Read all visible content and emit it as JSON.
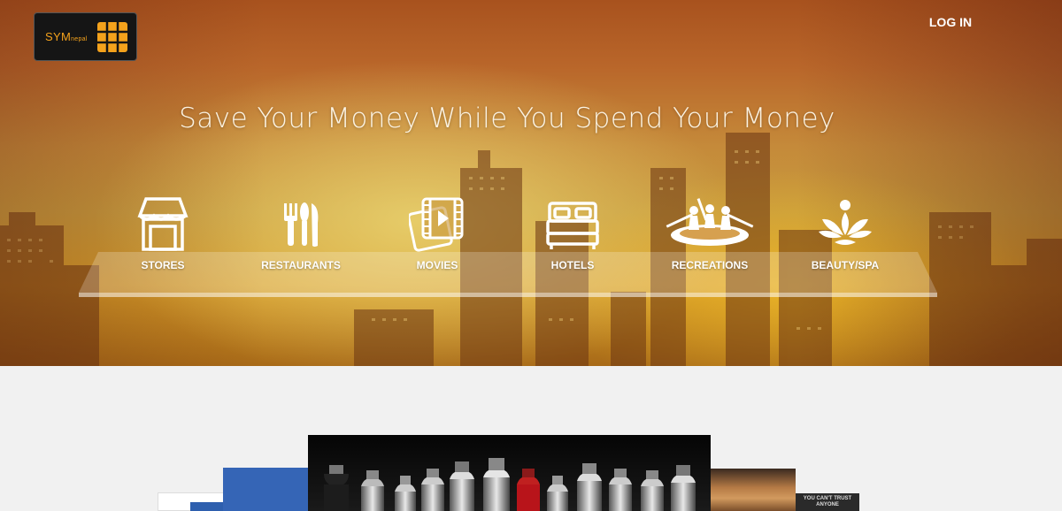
{
  "header": {
    "logo": {
      "name": "SYM",
      "sub": "nepal"
    },
    "login_label": "LOG IN"
  },
  "hero": {
    "tagline": "Save Your Money While You Spend Your Money"
  },
  "categories": [
    {
      "label": "STORES",
      "icon": "store-icon"
    },
    {
      "label": "RESTAURANTS",
      "icon": "cutlery-icon"
    },
    {
      "label": "MOVIES",
      "icon": "movie-icon"
    },
    {
      "label": "HOTELS",
      "icon": "bed-icon"
    },
    {
      "label": "RECREATIONS",
      "icon": "rafting-icon"
    },
    {
      "label": "BEAUTY/SPA",
      "icon": "lotus-icon"
    }
  ],
  "carousel": {
    "poster_text": "YOU CAN'T TRUST ANYONE"
  },
  "colors": {
    "accent": "#f4a21c",
    "hero_gold": "#d59a28",
    "hero_rust": "#a8521e",
    "page_bg": "#f1f1f1"
  }
}
